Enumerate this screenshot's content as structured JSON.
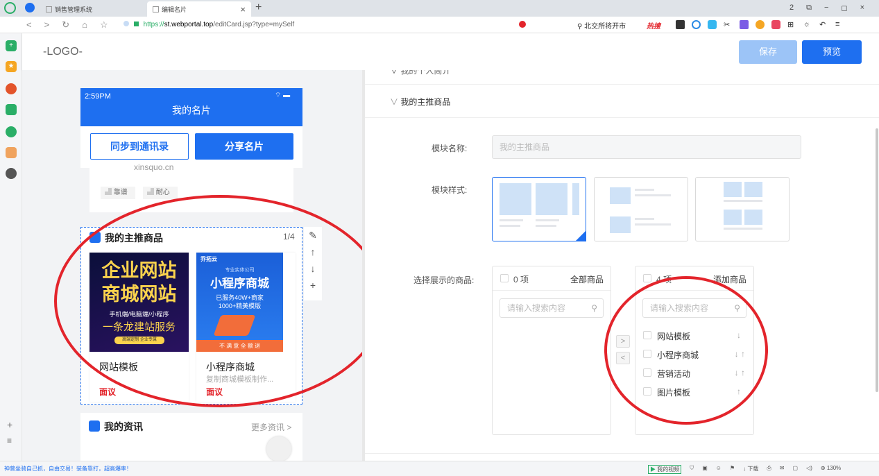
{
  "browser": {
    "tabs": [
      {
        "label": "销售管理系统"
      },
      {
        "label": "编辑名片"
      }
    ],
    "new_tab": "+",
    "tab_close": "×",
    "url_scheme": "https://",
    "url_host": "st.webportal.top",
    "url_path": "/editCard.jsp?type=mySelf",
    "search_text": "北交所将开市",
    "hot_label": "热搜",
    "window_controls": [
      "2",
      "⧉",
      "−",
      "◻",
      "×"
    ],
    "statusbar_left": "神曾坐骑自己抓，自由交易！装备靠打，超高爆率！",
    "statusbar_right": [
      "我的视频",
      "下载",
      "130%"
    ]
  },
  "app": {
    "logo": "-LOGO-",
    "save_label": "保存",
    "preview_label": "预览"
  },
  "phone": {
    "time": "2:59PM",
    "title": "我的名片",
    "sync_btn": "同步到通讯录",
    "share_btn": "分享名片",
    "partial_text": "xinsquo.cn",
    "tags": [
      "靠谱",
      "耐心"
    ],
    "module_title": "我的主推商品",
    "pager": "1/4",
    "products": [
      {
        "name": "网站模板",
        "desc": "",
        "price": "面议",
        "img_lines": [
          "企业网站",
          "商城网站",
          "手机端/电脑端/小程序",
          "一条龙建站服务",
          "高端定制 企业专属"
        ]
      },
      {
        "name": "小程序商城",
        "desc": "复制商城模板制作...",
        "price": "面议",
        "img_lines": [
          "乔拓云",
          "专业实体公司",
          "小程序商城",
          "已服务40W+商家",
          "1000+精美模版",
          "不 满 意 全 额 退"
        ]
      }
    ],
    "news_title": "我的资讯",
    "news_more": "更多资讯 >"
  },
  "editor": {
    "collapsed_section": "我的个人简介",
    "section_title": "我的主推商品",
    "module_name_label": "模块名称:",
    "module_name_value": "我的主推商品",
    "module_style_label": "模块样式:",
    "select_label": "选择展示的商品:",
    "left_list": {
      "count": "0 项",
      "title": "全部商品",
      "search_placeholder": "请输入搜索内容"
    },
    "right_list": {
      "count": "4 项",
      "title": "添加商品",
      "search_placeholder": "请输入搜索内容",
      "items": [
        {
          "label": "网站模板",
          "arrows": "↓"
        },
        {
          "label": "小程序商城",
          "arrows": "↓ ↑"
        },
        {
          "label": "营销活动",
          "arrows": "↓ ↑"
        },
        {
          "label": "图片模板",
          "arrows": "↑"
        }
      ]
    },
    "transfer_right": ">",
    "transfer_left": "<"
  },
  "colors": {
    "accent": "#1e6ff0",
    "annotation": "#e3242b",
    "price": "#e3242b"
  }
}
